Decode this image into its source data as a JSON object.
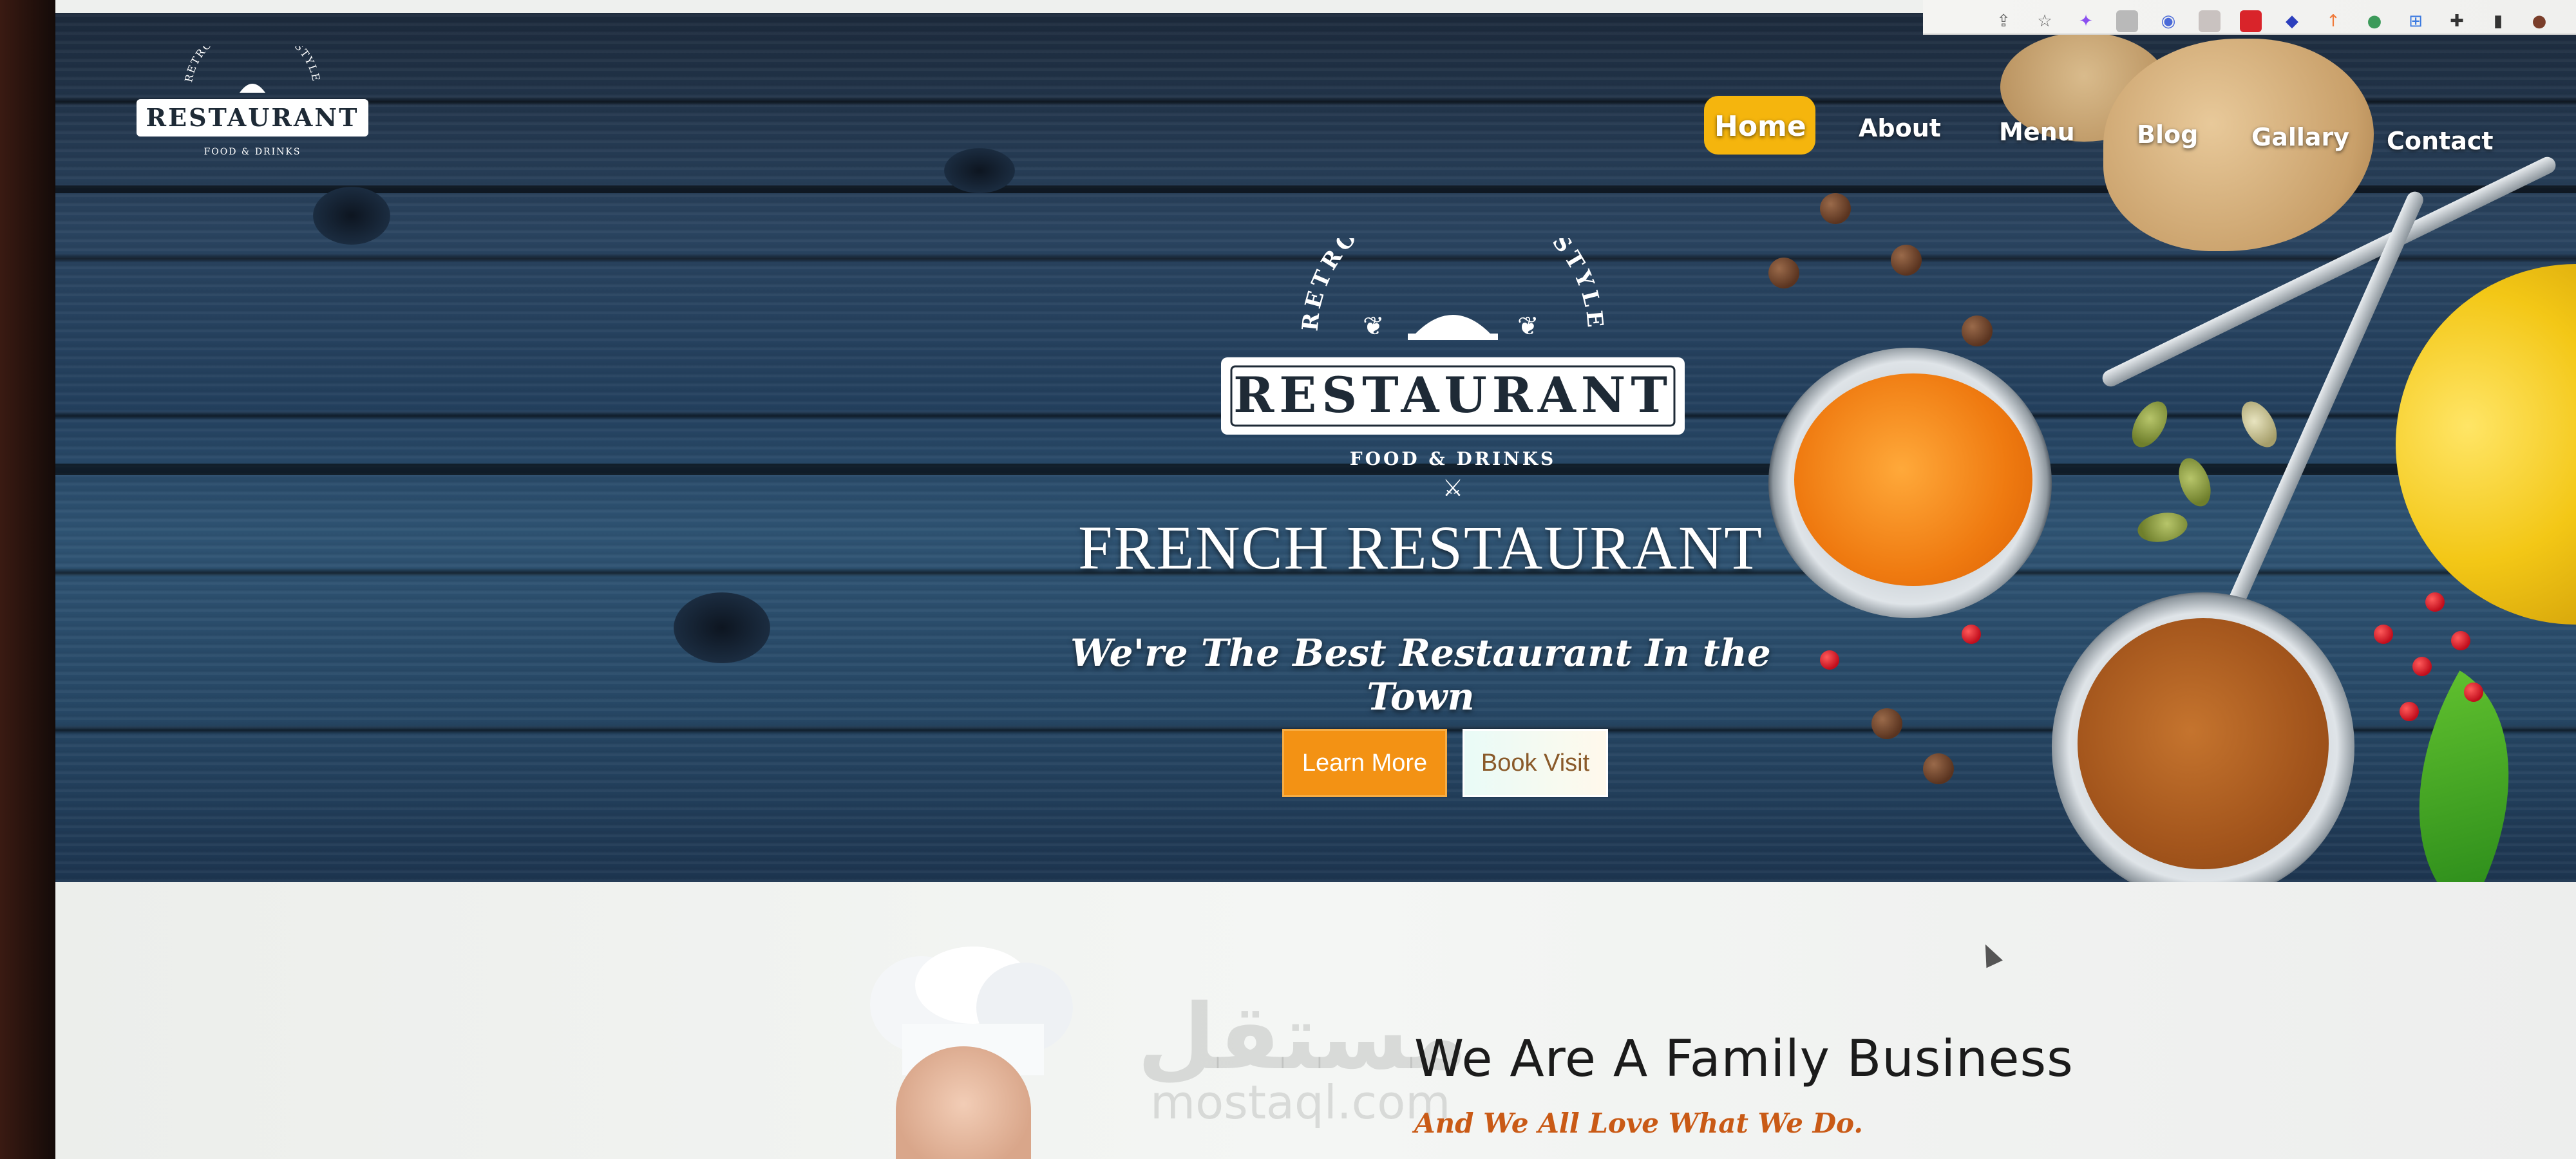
{
  "browser": {
    "extension_icons": [
      "share-icon",
      "star-icon",
      "puzzle-ext-icon",
      "ext-gray-icon",
      "ext-circle-icon",
      "ext-photo-icon",
      "ext-red-icon",
      "ext-blue-diamond-icon",
      "ext-arrow-icon",
      "ext-globe-icon",
      "translate-icon",
      "extensions-puzzle-icon",
      "sidebar-icon",
      "profile-avatar-icon"
    ]
  },
  "site": {
    "logo": {
      "arc_text": "RETRO AUTHENTIC STYLE",
      "name": "RESTAURANT",
      "tagline": "FOOD & DRINKS"
    },
    "nav": {
      "items": [
        {
          "label": "Home",
          "active": true
        },
        {
          "label": "About",
          "active": false
        },
        {
          "label": "Menu",
          "active": false
        },
        {
          "label": "Blog",
          "active": false
        },
        {
          "label": "Gallary",
          "active": false
        },
        {
          "label": "Contact",
          "active": false
        }
      ]
    },
    "hero": {
      "title": "FRENCH RESTAURANT",
      "subtitle": "We're The Best Restaurant In the Town",
      "primary_button": "Learn More",
      "secondary_button": "Book Visit"
    },
    "about": {
      "title": "We Are A Family Business",
      "subtitle": "And We All Love What We Do.",
      "watermark_arabic": "مستقل",
      "watermark_latin": "mostaql.com"
    }
  },
  "colors": {
    "accent": "#f5b50d",
    "button_primary": "#f39214",
    "subtitle_accent": "#c95a16"
  }
}
